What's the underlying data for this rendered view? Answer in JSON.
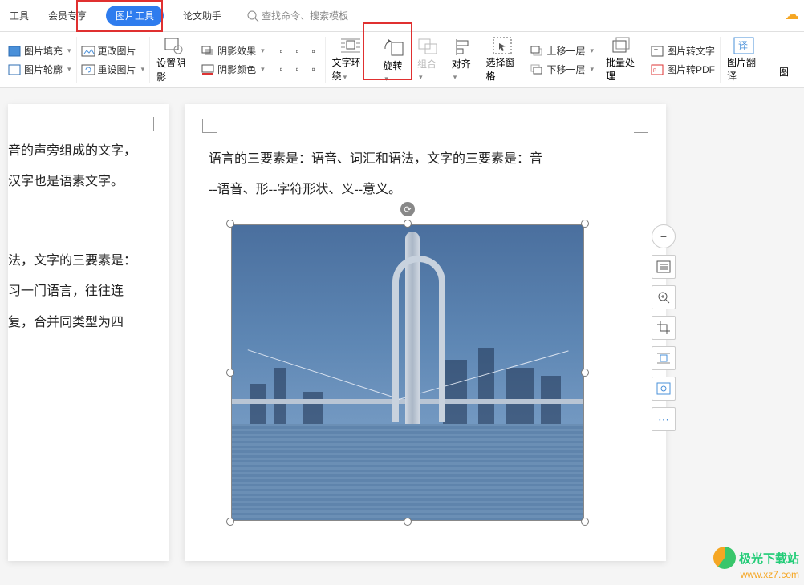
{
  "menubar": {
    "tool": "工具",
    "member": "会员专享",
    "pic_tools": "图片工具",
    "thesis": "论文助手",
    "search_placeholder": "查找命令、搜索模板"
  },
  "ribbon": {
    "fill": "图片填充",
    "outline": "图片轮廓",
    "change": "更改图片",
    "reset": "重设图片",
    "set_shadow": "设置阴影",
    "shadow_effect": "阴影效果",
    "shadow_color": "阴影颜色",
    "text_wrap": "文字环绕",
    "rotate": "旋转",
    "group": "组合",
    "align": "对齐",
    "select_pane": "选择窗格",
    "bring_forward": "上移一层",
    "send_backward": "下移一层",
    "batch": "批量处理",
    "to_text": "图片转文字",
    "to_pdf": "图片转PDF",
    "translate": "图片翻译",
    "pic_extra": "图"
  },
  "doc_left": {
    "l1": "音的声旁组成的文字，",
    "l2": "汉字也是语素文字。",
    "l3": "法，文字的三要素是：",
    "l4": "习一门语言，往往连",
    "l5": "复，合并同类型为四"
  },
  "doc_right": {
    "p1": "语言的三要素是：语音、词汇和语法，文字的三要素是：音",
    "p2": "--语音、形--字符形状、义--意义。"
  },
  "side_tools": {
    "t1": "layout-options",
    "t2": "zoom",
    "t3": "crop",
    "t4": "wrap",
    "t5": "edit",
    "t6": "more"
  },
  "watermark": {
    "site_name": "极光下载站",
    "url": "www.xz7.com"
  }
}
